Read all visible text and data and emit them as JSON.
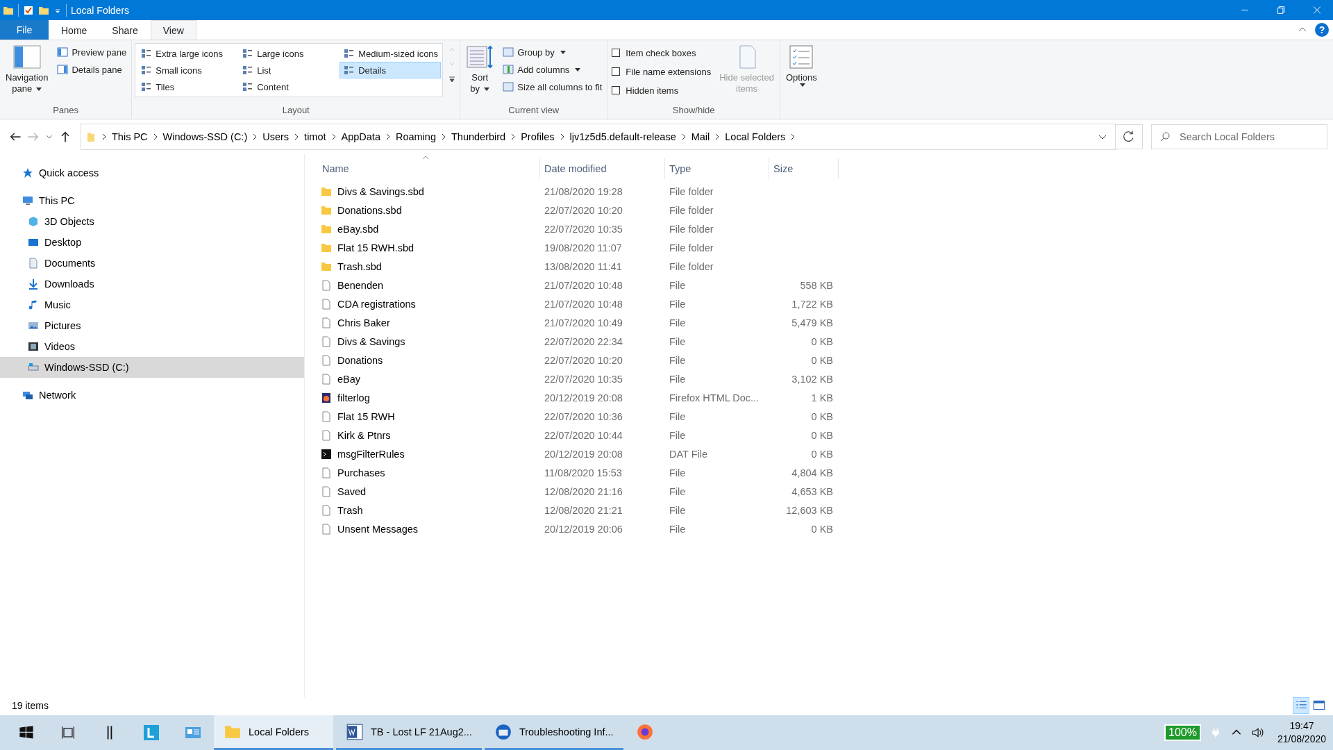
{
  "window": {
    "title": "Local Folders"
  },
  "ribbon": {
    "help": "?",
    "tabs": [
      {
        "label": "File",
        "kind": "file",
        "selected": false
      },
      {
        "label": "Home",
        "kind": "tab",
        "selected": false
      },
      {
        "label": "Share",
        "kind": "tab",
        "selected": false
      },
      {
        "label": "View",
        "kind": "tab",
        "selected": true
      }
    ],
    "panes": {
      "label": "Panes",
      "navigation": [
        "Navigation",
        "pane"
      ],
      "items": [
        "Preview pane",
        "Details pane"
      ]
    },
    "layout": {
      "label": "Layout",
      "items": [
        {
          "label": "Extra large icons",
          "selected": false
        },
        {
          "label": "Small icons",
          "selected": false
        },
        {
          "label": "Tiles",
          "selected": false
        },
        {
          "label": "Large icons",
          "selected": false
        },
        {
          "label": "List",
          "selected": false
        },
        {
          "label": "Content",
          "selected": false
        },
        {
          "label": "Medium-sized icons",
          "selected": false
        },
        {
          "label": "Details",
          "selected": true
        }
      ]
    },
    "current_view": {
      "label": "Current view",
      "sort": [
        "Sort",
        "by"
      ],
      "items": [
        "Group by",
        "Add columns",
        "Size all columns to fit"
      ]
    },
    "show_hide": {
      "label": "Show/hide",
      "checkboxes": [
        {
          "label": "Item check boxes",
          "checked": false
        },
        {
          "label": "File name extensions",
          "checked": false
        },
        {
          "label": "Hidden items",
          "checked": false
        }
      ],
      "hide_selected": {
        "label": [
          "Hide selected",
          "items"
        ],
        "disabled": true
      }
    },
    "options": {
      "label": "Options"
    }
  },
  "address": {
    "breadcrumbs": [
      "This PC",
      "Windows-SSD (C:)",
      "Users",
      "timot",
      "AppData",
      "Roaming",
      "Thunderbird",
      "Profiles",
      "ljv1z5d5.default-release",
      "Mail",
      "Local Folders"
    ]
  },
  "search": {
    "placeholder": "Search Local Folders"
  },
  "sidebar": {
    "items": [
      {
        "label": "Quick access",
        "kind": "star",
        "selected": false
      },
      {
        "label": "This PC",
        "kind": "pc",
        "selected": false,
        "children": [
          {
            "label": "3D Objects",
            "kind": "cube",
            "selected": false
          },
          {
            "label": "Desktop",
            "kind": "desktop",
            "selected": false
          },
          {
            "label": "Documents",
            "kind": "doc",
            "selected": false
          },
          {
            "label": "Downloads",
            "kind": "download",
            "selected": false
          },
          {
            "label": "Music",
            "kind": "music",
            "selected": false
          },
          {
            "label": "Pictures",
            "kind": "pictures",
            "selected": false
          },
          {
            "label": "Videos",
            "kind": "videos",
            "selected": false
          },
          {
            "label": "Windows-SSD (C:)",
            "kind": "drive",
            "selected": true
          }
        ]
      },
      {
        "label": "Network",
        "kind": "network",
        "selected": false
      }
    ]
  },
  "table": {
    "columns": [
      "Name",
      "Date modified",
      "Type",
      "Size"
    ],
    "rows": [
      {
        "kind": "folder",
        "name": "Divs & Savings.sbd",
        "date": "21/08/2020 19:28",
        "type": "File folder"
      },
      {
        "kind": "folder",
        "name": "Donations.sbd",
        "date": "22/07/2020 10:20",
        "type": "File folder"
      },
      {
        "kind": "folder",
        "name": "eBay.sbd",
        "date": "22/07/2020 10:35",
        "type": "File folder"
      },
      {
        "kind": "folder",
        "name": "Flat 15 RWH.sbd",
        "date": "19/08/2020 11:07",
        "type": "File folder"
      },
      {
        "kind": "folder",
        "name": "Trash.sbd",
        "date": "13/08/2020 11:41",
        "type": "File folder"
      },
      {
        "kind": "file",
        "name": "Benenden",
        "date": "21/07/2020 10:48",
        "type": "File",
        "size": "558 KB"
      },
      {
        "kind": "file",
        "name": "CDA registrations",
        "date": "21/07/2020 10:48",
        "type": "File",
        "size": "1,722 KB"
      },
      {
        "kind": "file",
        "name": "Chris Baker",
        "date": "21/07/2020 10:49",
        "type": "File",
        "size": "5,479 KB"
      },
      {
        "kind": "file",
        "name": "Divs & Savings",
        "date": "22/07/2020 22:34",
        "type": "File",
        "size": "0 KB"
      },
      {
        "kind": "file",
        "name": "Donations",
        "date": "22/07/2020 10:20",
        "type": "File",
        "size": "0 KB"
      },
      {
        "kind": "file",
        "name": "eBay",
        "date": "22/07/2020 10:35",
        "type": "File",
        "size": "3,102 KB"
      },
      {
        "kind": "html",
        "name": "filterlog",
        "date": "20/12/2019 20:08",
        "type": "Firefox HTML Doc...",
        "size": "1 KB"
      },
      {
        "kind": "file",
        "name": "Flat 15 RWH",
        "date": "22/07/2020 10:36",
        "type": "File",
        "size": "0 KB"
      },
      {
        "kind": "file",
        "name": "Kirk & Ptnrs",
        "date": "22/07/2020 10:44",
        "type": "File",
        "size": "0 KB"
      },
      {
        "kind": "dat",
        "name": "msgFilterRules",
        "date": "20/12/2019 20:08",
        "type": "DAT File",
        "size": "0 KB"
      },
      {
        "kind": "file",
        "name": "Purchases",
        "date": "11/08/2020 15:53",
        "type": "File",
        "size": "4,804 KB"
      },
      {
        "kind": "file",
        "name": "Saved",
        "date": "12/08/2020 21:16",
        "type": "File",
        "size": "4,653 KB"
      },
      {
        "kind": "file",
        "name": "Trash",
        "date": "12/08/2020 21:21",
        "type": "File",
        "size": "12,603 KB"
      },
      {
        "kind": "file",
        "name": "Unsent Messages",
        "date": "20/12/2019 20:06",
        "type": "File",
        "size": "0 KB"
      }
    ]
  },
  "status_bar": {
    "count": "19 items",
    "view_buttons": [
      {
        "kind": "details",
        "selected": true
      },
      {
        "kind": "tiles",
        "selected": false
      }
    ]
  },
  "taskbar": {
    "apps": [
      {
        "kind": "folder",
        "label": "Local Folders",
        "active": true
      },
      {
        "kind": "word",
        "label": "TB - Lost LF 21Aug2...",
        "active": false
      },
      {
        "kind": "thunderbird",
        "label": "Troubleshooting Inf...",
        "active": false
      },
      {
        "kind": "firefox",
        "active": false
      }
    ],
    "battery": "100%",
    "time": "19:47",
    "date": "21/08/2020"
  }
}
